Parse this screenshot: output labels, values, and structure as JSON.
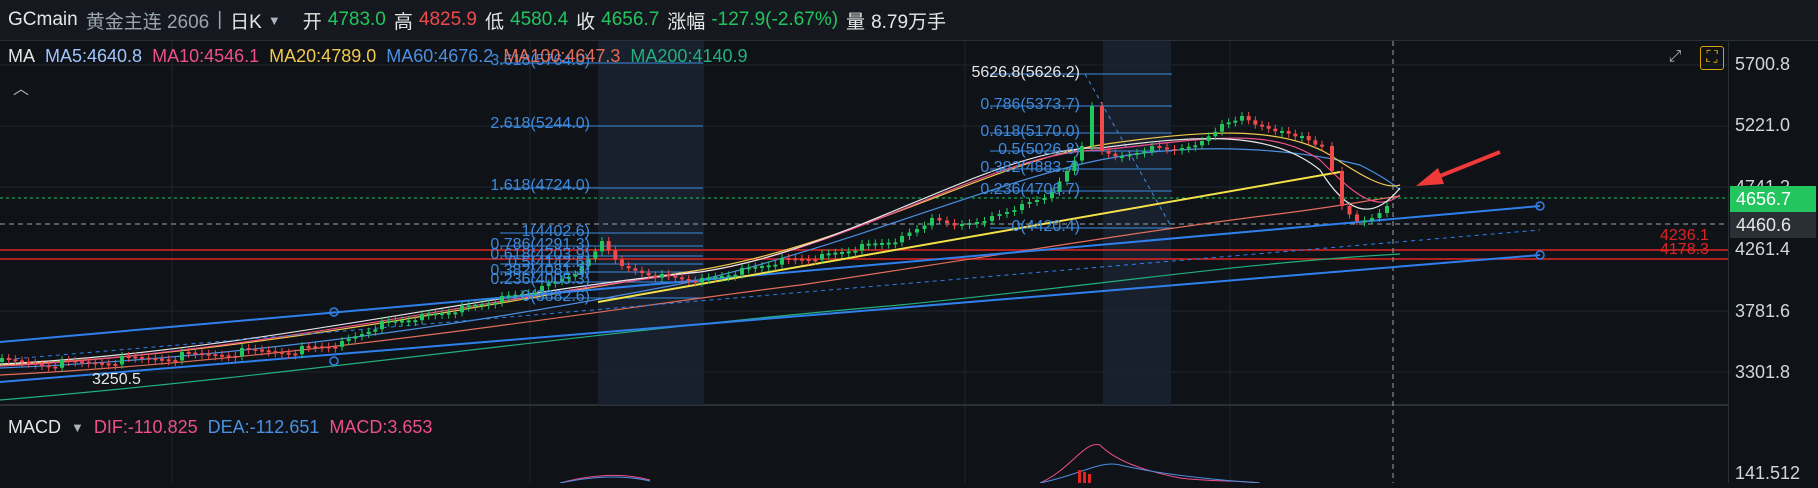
{
  "header": {
    "symbol": "GCmain",
    "name": "黄金主连 2606",
    "separator": "|",
    "period": "日K",
    "open_label": "开",
    "open_value": "4783.0",
    "high_label": "高",
    "high_value": "4825.9",
    "low_label": "低",
    "low_value": "4580.4",
    "close_label": "收",
    "close_value": "4656.7",
    "change_label": "涨幅",
    "change_value": "-127.9(-2.67%)",
    "volume_label": "量",
    "volume_value": "8.79万手"
  },
  "ma_legend": {
    "title": "MA",
    "ma5": "MA5:4640.8",
    "ma10": "MA10:4546.1",
    "ma20": "MA20:4789.0",
    "ma60": "MA60:4676.2",
    "ma100": "MA100:4647.3",
    "ma200": "MA200:4140.9"
  },
  "macd_legend": {
    "title": "MACD",
    "dif": "DIF:-110.825",
    "dea": "DEA:-112.651",
    "macd": "MACD:3.653"
  },
  "price_axis": [
    "5700.8",
    "5221.0",
    "4741.2",
    "4261.4",
    "3781.6",
    "3301.8"
  ],
  "macd_axis": [
    "141.512"
  ],
  "badges": {
    "last_price": "4656.7",
    "crosshair_price": "4460.6"
  },
  "red_levels": [
    "4236.1",
    "4178.3"
  ],
  "low_label": "3250.5",
  "fib_left": [
    "3.618(5764.0)",
    "2.618(5244.0)",
    "1.618(4724.0)",
    "1(4402.6)",
    "0.786(4291.3)",
    "0.618(4203.9)",
    "0.5(4142.6)",
    "0.382(4081.3)",
    "0.236(4005.3)",
    "0(3882.6)"
  ],
  "fib_right": [
    "5626.8(5626.2)",
    "0.786(5373.7)",
    "0.618(5170.0)",
    "0.5(5026.8)",
    "0.382(4883.7)",
    "0.236(4706.7)",
    "0(4420.4)"
  ],
  "colors": {
    "up": "#22c55e",
    "down": "#f04a4a",
    "ma5": "#e6e6e6",
    "ma10": "#ef4f8a",
    "ma20": "#f2c94c",
    "ma60": "#4a90e2",
    "ma100": "#e26d5a",
    "ma200": "#22b07d",
    "fib": "#3d8be0",
    "trend": "#2f80ed",
    "yellow": "#f5e14a"
  },
  "icons": [
    "expand-icon",
    "settings-icon",
    "collapse-up-icon",
    "dropdown-caret-icon"
  ]
}
